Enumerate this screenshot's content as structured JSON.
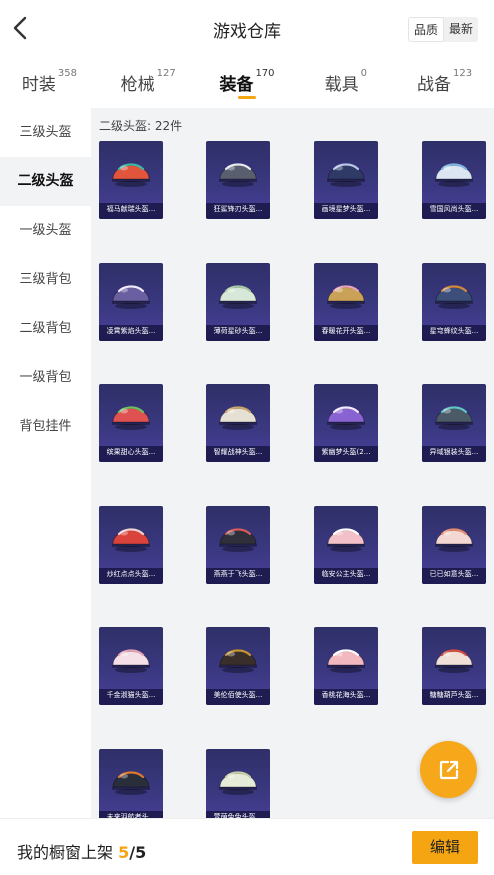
{
  "header": {
    "title": "游戏仓库",
    "sort_options": [
      "品质",
      "最新"
    ],
    "sort_selected": "品质"
  },
  "tabs": [
    {
      "label": "时装",
      "count": "358"
    },
    {
      "label": "枪械",
      "count": "127"
    },
    {
      "label": "装备",
      "count": "170",
      "active": true
    },
    {
      "label": "载具",
      "count": "0"
    },
    {
      "label": "战备",
      "count": "123"
    }
  ],
  "sidebar": {
    "items": [
      "三级头盔",
      "二级头盔",
      "一级头盔",
      "三级背包",
      "二级背包",
      "一级背包",
      "背包挂件"
    ],
    "active_index": 1
  },
  "section": {
    "label": "二级头盔: 22件"
  },
  "items": [
    {
      "name": "福马献瑞头盔...",
      "color": "#e0553c",
      "accent": "#3fb9a5"
    },
    {
      "name": "狂鲨锋刃头盔...",
      "color": "#5a5f70",
      "accent": "#e8e8ee"
    },
    {
      "name": "画境星梦头盔...",
      "color": "#2f3a66",
      "accent": "#b9c8e8"
    },
    {
      "name": "雪国风尚头盔...",
      "color": "#dbe6f2",
      "accent": "#7fb3e0"
    },
    {
      "name": "凌霄紫焰头盔...",
      "color": "#6a5fa0",
      "accent": "#f0eaff"
    },
    {
      "name": "薄荷星砂头盔...",
      "color": "#d8e8d8",
      "accent": "#a8c8a8"
    },
    {
      "name": "春暖花开头盔...",
      "color": "#c9a258",
      "accent": "#e8a6b8"
    },
    {
      "name": "星穹蜂纹头盔...",
      "color": "#3c4f7a",
      "accent": "#d48a3c"
    },
    {
      "name": "缤果甜心头盔...",
      "color": "#e05252",
      "accent": "#6fbf60"
    },
    {
      "name": "智耀战神头盔...",
      "color": "#e6e0d4",
      "accent": "#c8a56a"
    },
    {
      "name": "紫幽梦头盔(2...",
      "color": "#8a63d2",
      "accent": "#f3e9ff"
    },
    {
      "name": "异域银装头盔...",
      "color": "#4a5a66",
      "accent": "#5fc6c8"
    },
    {
      "name": "炒红点点头盔...",
      "color": "#d9433c",
      "accent": "#f5d3d0"
    },
    {
      "name": "燕燕于飞头盔...",
      "color": "#2e2f3a",
      "accent": "#d85a5a"
    },
    {
      "name": "临安公主头盔...",
      "color": "#f2c0c8",
      "accent": "#ffffff"
    },
    {
      "name": "已已如意头盔...",
      "color": "#f3d7d2",
      "accent": "#e58b6c"
    },
    {
      "name": "千金淑猫头盔...",
      "color": "#f5e0e8",
      "accent": "#e6a3b7"
    },
    {
      "name": "美伦佰使头盔...",
      "color": "#3a2e2a",
      "accent": "#c9962e"
    },
    {
      "name": "香桃花海头盔...",
      "color": "#f2b8c0",
      "accent": "#ffffff"
    },
    {
      "name": "糖糖葫芦头盔...",
      "color": "#f0e0d8",
      "accent": "#d64b3c"
    },
    {
      "name": "未来羽航者头...",
      "color": "#2a2d3a",
      "accent": "#e07a2e"
    },
    {
      "name": "萱萌兔兔头盔...",
      "color": "#e6ead8",
      "accent": "#c8cfa8"
    }
  ],
  "footer": {
    "showcase_label": "我的橱窗上架",
    "current": "5",
    "separator": "/",
    "max": "5",
    "edit_label": "编辑"
  },
  "icons": {
    "back": "chevron-left-icon",
    "share": "external-link-icon"
  },
  "colors": {
    "accent": "#f5a512",
    "card_bg": "#3a3880",
    "content_bg": "#f2f3f5"
  }
}
